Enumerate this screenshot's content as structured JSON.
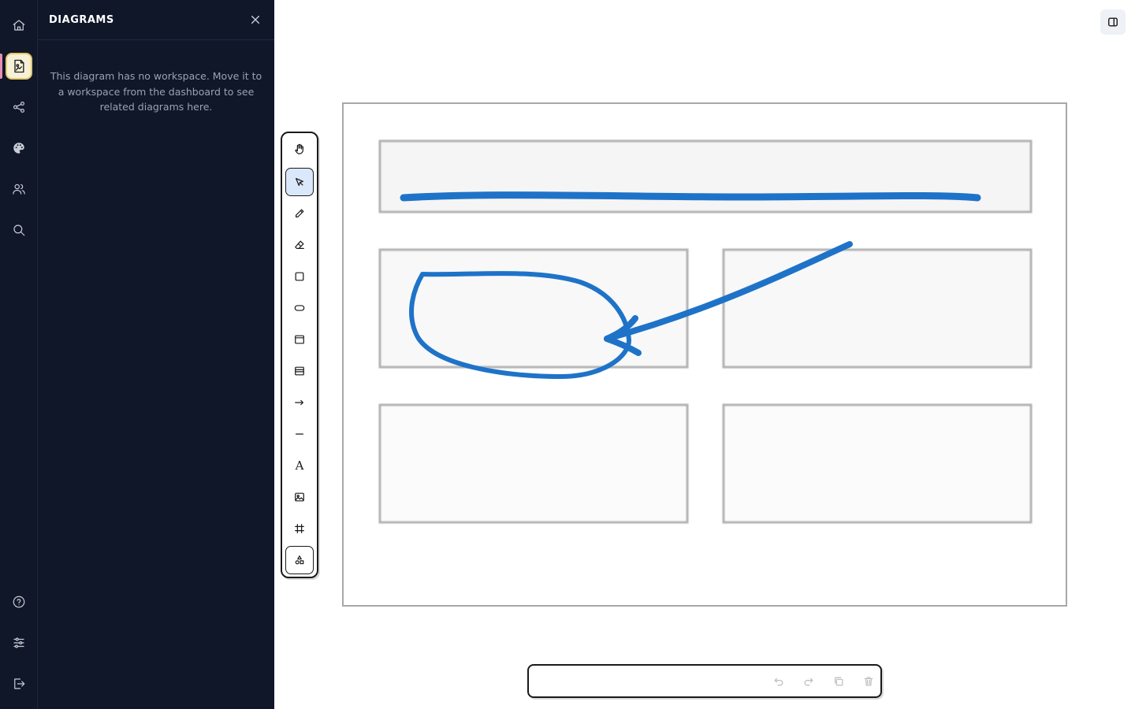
{
  "sidebar_panel": {
    "title": "DIAGRAMS",
    "message": "This diagram has no workspace. Move it to a workspace from the dashboard to see related diagrams here."
  },
  "rail": {
    "top_items": [
      "home-icon",
      "diagram-icon",
      "share-icon",
      "palette-icon",
      "users-icon",
      "search-icon"
    ],
    "bottom_items": [
      "help-icon",
      "settings-sliders-icon",
      "logout-icon"
    ],
    "active_item": "diagram-icon",
    "active_accent": "#e6c86a",
    "indicator_color": "#e58fb4"
  },
  "tools": {
    "items": [
      "hand-icon",
      "select-icon",
      "pencil-icon",
      "eraser-icon",
      "rectangle-icon",
      "ellipse-icon",
      "browser-window-icon",
      "list-icon",
      "arrow-icon",
      "line-icon",
      "text-icon",
      "image-icon",
      "frame-icon",
      "shapes-icon"
    ],
    "selected": "select-icon",
    "text_tool_glyph": "A"
  },
  "canvas": {
    "stroke_color": "#1e73c8",
    "box_border_color": "#b0b0b0",
    "box_fill": "#f5f5f5"
  },
  "action_bar": {
    "items": [
      "undo-icon",
      "redo-icon",
      "duplicate-icon",
      "delete-icon"
    ]
  },
  "colors": {
    "sidebar_bg": "#0f1729",
    "selected_tool_bg": "#dbe7fa"
  }
}
